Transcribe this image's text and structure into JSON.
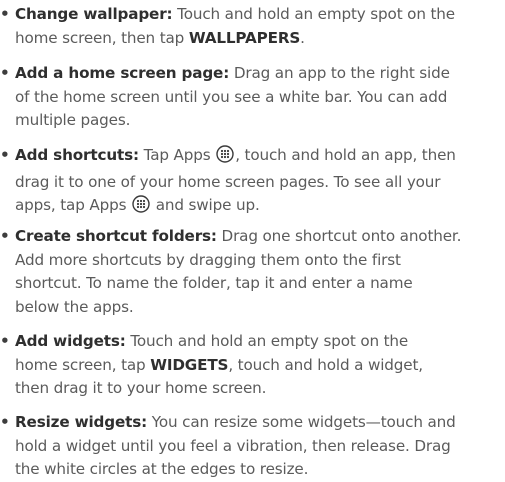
{
  "bullet": "•",
  "items": [
    {
      "term": "Change wallpaper:",
      "text_1": " Touch and hold an empty spot on the",
      "text_2": "home screen, then tap ",
      "strong_1": "WALLPAPERS",
      "text_3": "."
    },
    {
      "term": "Add a home screen page:",
      "text_1": " Drag an app to the right side",
      "text_2": "of the home screen until you see a white bar. You can add",
      "text_3": "multiple pages."
    },
    {
      "term": "Add shortcuts:",
      "text_1": " Tap Apps ",
      "text_2": ", touch and hold an app, then",
      "text_3": "drag it to one of your home screen pages. To see all your",
      "text_4": "apps, tap Apps ",
      "text_5": " and swipe up."
    },
    {
      "term": "Create shortcut folders:",
      "text_1": " Drag one shortcut onto another.",
      "text_2": "Add more shortcuts by dragging them onto the first",
      "text_3": "shortcut. To name the folder, tap it and enter a name",
      "text_4": "below the apps."
    },
    {
      "term": "Add widgets:",
      "text_1": " Touch and hold an empty spot on the",
      "text_2": "home screen, tap ",
      "strong_1": "WIDGETS",
      "text_3": ", touch and hold a widget,",
      "text_4": "then drag it to your home screen."
    },
    {
      "term": "Resize widgets:",
      "text_1": " You can resize some widgets—touch and",
      "text_2": "hold a widget until you feel a vibration, then release. Drag",
      "text_3": "the white circles at the edges to resize."
    }
  ]
}
